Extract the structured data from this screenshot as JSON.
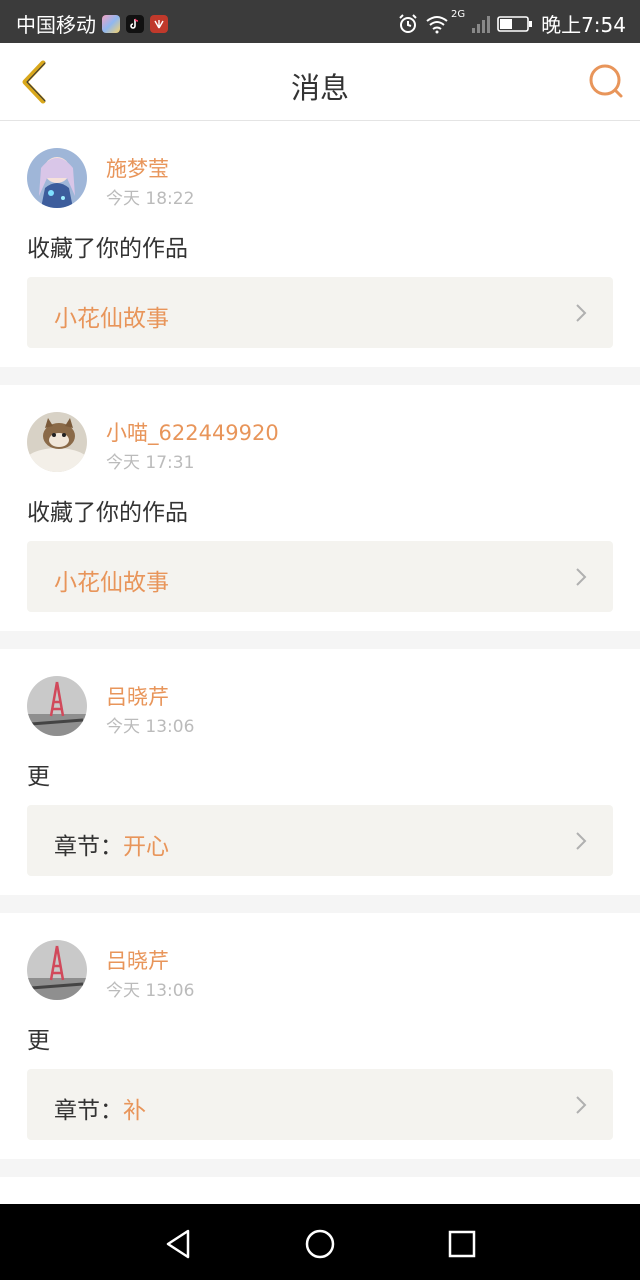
{
  "status_bar": {
    "carrier": "中国移动",
    "network": "2G",
    "time": "晚上7:54",
    "apps": [
      "app-icon-1",
      "tiktok-icon",
      "huawei-icon"
    ]
  },
  "navbar": {
    "title": "消息"
  },
  "messages": [
    {
      "user": "施梦莹",
      "time": "今天 18:22",
      "action": "收藏了你的作品",
      "work_prefix": "",
      "work_title": "小花仙故事"
    },
    {
      "user": "小喵_622449920",
      "time": "今天 17:31",
      "action": "收藏了你的作品",
      "work_prefix": "",
      "work_title": "小花仙故事"
    },
    {
      "user": "吕晓芹",
      "time": "今天 13:06",
      "action": "更",
      "work_prefix": "章节：",
      "work_title": "开心"
    },
    {
      "user": "吕晓芹",
      "time": "今天 13:06",
      "action": "更",
      "work_prefix": "章节：",
      "work_title": "补"
    }
  ],
  "colors": {
    "accent": "#e8955a",
    "back_icon": "#d9a81c",
    "status_bar": "#3b3b3b",
    "work_box": "#f4f3ef"
  }
}
